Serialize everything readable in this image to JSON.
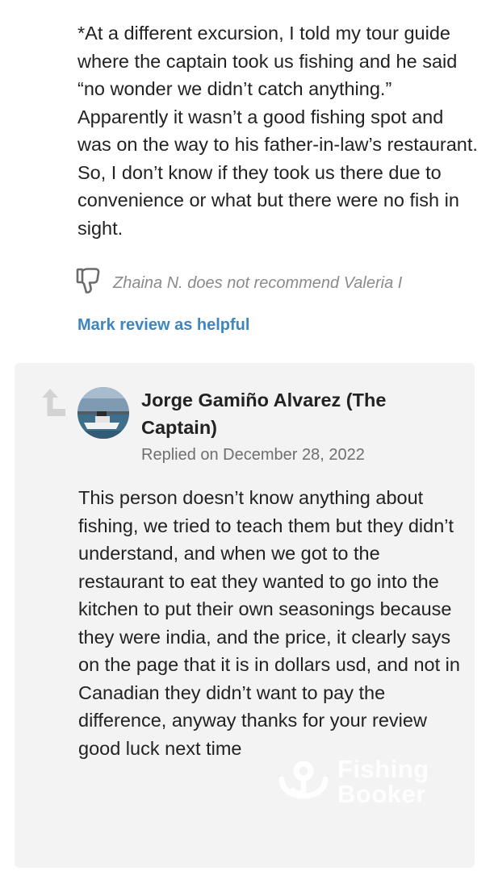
{
  "review": {
    "text": "*At a different excursion, I told my tour guide where the captain took us fishing and he said “no wonder we didn’t catch anything.” Apparently it wasn’t a good fishing spot and was on the way to his father-in-law’s restaurant. So, I don’t know if they took us there due to convenience or what but there were no fish in sight.",
    "recommendation": "Zhaina N. does not recommend Valeria I",
    "helpful_label": "Mark review as helpful"
  },
  "reply": {
    "author": "Jorge Gamiño Alvarez (The Captain)",
    "date": "Replied on December 28, 2022",
    "text": "This person doesn’t know anything about fishing, we tried to teach them but they didn’t understand, and when we got to the restaurant to eat they wanted to go into the kitchen to put their own seasonings because they were india, and the price, it clearly says on the page that it is in dollars usd, and not in Canadian they didn’t want to pay the difference, anyway thanks for your review good luck next time"
  },
  "watermark": {
    "brand_line1": "Fishing",
    "brand_line2": "Booker"
  },
  "colors": {
    "link": "#3d86c2",
    "reply_background": "#f3f3f3",
    "muted_text": "#8a8a8a"
  },
  "icons": {
    "recommendation": "thumbs-down-icon",
    "reply": "reply-arrow-icon"
  }
}
